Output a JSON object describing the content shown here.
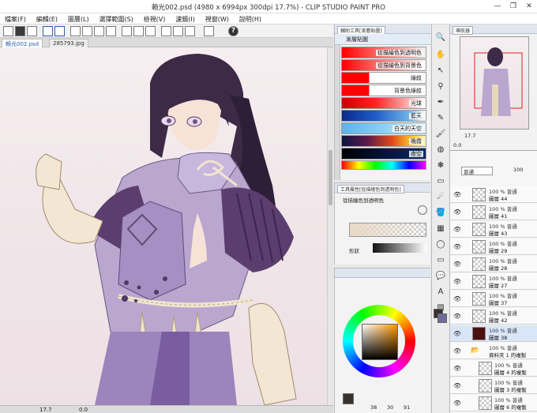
{
  "window": {
    "title": "賴光002.psd (4980 x 6994px 300dpi 17.7%)  - CLIP STUDIO PAINT PRO",
    "min": "—",
    "max": "❐",
    "close": "✕"
  },
  "menu": [
    "檔案(F)",
    "編輯(E)",
    "圖層(L)",
    "選擇範圍(S)",
    "檢視(V)",
    "濾鏡(I)",
    "視窗(W)",
    "說明(H)"
  ],
  "doc_tabs": [
    "賴光002.psd",
    "285793.jpg"
  ],
  "status": {
    "zoom": "17.7",
    "angle": "0.0"
  },
  "sub_tool": {
    "tab_label": "輔助工具[漸層貼圖]",
    "group_label": "漸層貼圖",
    "gradients": [
      {
        "label": "從描繪色到透明色",
        "css": "linear-gradient(90deg,#ff0000 0%,rgba(255,0,0,0) 100%)"
      },
      {
        "label": "從描繪色到背景色",
        "css": "linear-gradient(90deg,#ff0000 0%,#ffffff 100%)"
      },
      {
        "label": "綠紋",
        "css": "linear-gradient(90deg,#ff0000 0%,#ff0000 32%,#ffffff 33%,#ffffff 100%)"
      },
      {
        "label": "背景色綠紋",
        "css": "linear-gradient(90deg,#ff0000 0%,#ff0000 32%,#ffffff 33%,#ffffff 100%)"
      },
      {
        "label": "光球",
        "css": "linear-gradient(90deg,#cc0000 0%,#ff2222 40%,#ffffff 100%)"
      },
      {
        "label": "藍天",
        "css": "linear-gradient(90deg,#0a2a8a 0%,#1f5cc8 40%,#6fb3e6 80%,#ffffff 100%)"
      },
      {
        "label": "白天的天空",
        "css": "linear-gradient(90deg,#5ab4ea 0%,#8ad0f3 50%,#e8f6ff 100%)"
      },
      {
        "label": "晚霞",
        "css": "linear-gradient(90deg,#0d1540 0%,#5a1a4a 30%,#e04a1a 60%,#ffcc33 85%,#fff5c0 100%)"
      },
      {
        "label": "夜空",
        "css": "linear-gradient(90deg,#000000 0%,#05123a 50%,#0a2a6a 100%)"
      }
    ],
    "rainbow_css": "linear-gradient(90deg,#ff0000,#ffff00,#00ff00,#00ffff,#0000ff,#ff00ff)"
  },
  "tool_property": {
    "title": "工具屬性[從描繪色到透明色]",
    "name": "從描繪色到透明色",
    "shape_label": "形狀"
  },
  "color": {
    "r": "38",
    "g": "30",
    "b": "91",
    "current": "#3a3030"
  },
  "layers": {
    "blend": "普通",
    "opacity": "100",
    "rows": [
      {
        "l1": "100 % 普通",
        "l2": "圖層 44"
      },
      {
        "l1": "100 % 普通",
        "l2": "圖層 41"
      },
      {
        "l1": "100 % 普通",
        "l2": "圖層 43"
      },
      {
        "l1": "100 % 普通",
        "l2": "圖層 29"
      },
      {
        "l1": "100 % 普通",
        "l2": "圖層 28"
      },
      {
        "l1": "100 % 普通",
        "l2": "圖層 27"
      },
      {
        "l1": "100 % 普通",
        "l2": "圖層 37"
      },
      {
        "l1": "100 % 普通",
        "l2": "圖層 42"
      },
      {
        "l1": "100 % 普通",
        "l2": "圖層 38"
      },
      {
        "l1": "100 % 普通",
        "l2": "資料夾 1 的複製"
      },
      {
        "l1": "100 % 普通",
        "l2": "圖層 4 的複製"
      },
      {
        "l1": "100 % 普通",
        "l2": "圖層 3 的複製"
      },
      {
        "l1": "100 % 普通",
        "l2": "圖層 6 的複製"
      }
    ]
  },
  "navigator": {
    "title": "導航器",
    "zoom": "17.7",
    "angle": "0.0"
  }
}
